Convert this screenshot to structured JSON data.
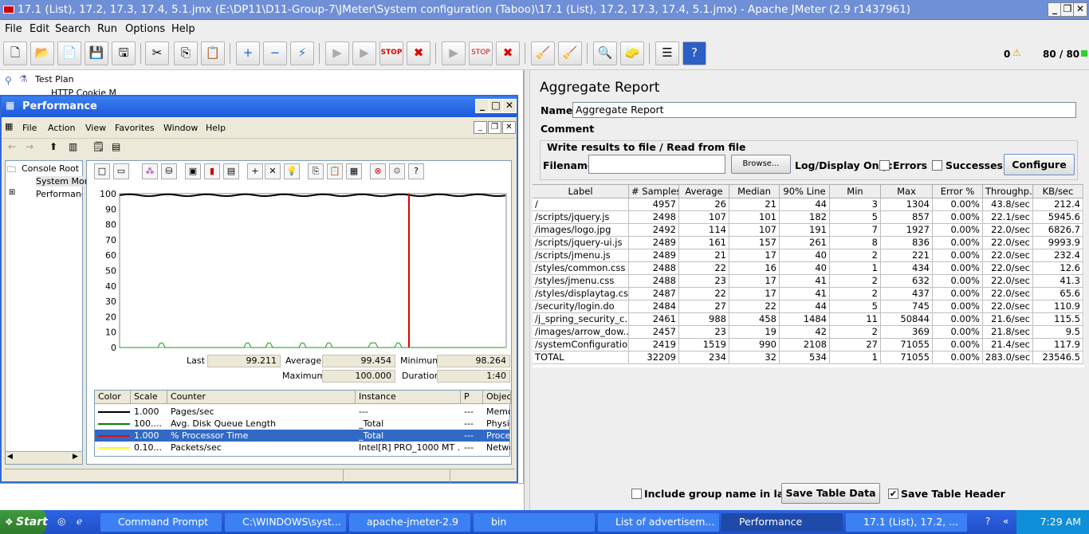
{
  "window": {
    "title": "17.1 (List), 17.2, 17.3, 17.4, 5.1.jmx (E:\\DP11\\D11-Group-7\\JMeter\\System configuration (Taboo)\\17.1 (List), 17.2, 17.3, 17.4, 5.1.jmx) - Apache JMeter (2.9 r1437961)"
  },
  "menu": [
    "File",
    "Edit",
    "Search",
    "Run",
    "Options",
    "Help"
  ],
  "status": {
    "errors": "0",
    "threads": "80 / 80"
  },
  "tree": {
    "test_plan": "Test Plan",
    "http_cookie": "HTTP Cookie M"
  },
  "perfmon": {
    "title": "Performance",
    "menu": [
      "File",
      "Action",
      "View",
      "Favorites",
      "Window",
      "Help"
    ],
    "tree": [
      "Console Root",
      "System Mon",
      "Performance"
    ],
    "y_ticks": [
      "100",
      "90",
      "80",
      "70",
      "60",
      "50",
      "40",
      "30",
      "20",
      "10",
      "0"
    ],
    "stats": {
      "last_label": "Last",
      "last": "99.211",
      "avg_label": "Average",
      "avg": "99.454",
      "min_label": "Minimum",
      "min": "98.264",
      "max_label": "Maximum",
      "max": "100.000",
      "dur_label": "Duration",
      "dur": "1:40"
    },
    "legend_headers": [
      "Color",
      "Scale",
      "Counter",
      "Instance",
      "P",
      "Object"
    ],
    "legend_rows": [
      {
        "color": "#000000",
        "scale": "1.000",
        "counter": "Pages/sec",
        "instance": "---",
        "p": "---",
        "object": "Memory"
      },
      {
        "color": "#008000",
        "scale": "100....",
        "counter": "Avg. Disk Queue Length",
        "instance": "_Total",
        "p": "---",
        "object": "PhysicalDisk"
      },
      {
        "color": "#ff0000",
        "scale": "1.000",
        "counter": "% Processor Time",
        "instance": "_Total",
        "p": "---",
        "object": "Processor"
      },
      {
        "color": "#ffff00",
        "scale": "0.10...",
        "counter": "Packets/sec",
        "instance": "Intel[R] PRO_1000 MT ...",
        "p": "---",
        "object": "Network"
      }
    ]
  },
  "report": {
    "title": "Aggregate Report",
    "name_label": "Name:",
    "name_value": "Aggregate Report",
    "comments_label": "Comments:",
    "fieldset": "Write results to file / Read from file",
    "filename_label": "Filename",
    "browse": "Browse...",
    "log_label": "Log/Display Only:",
    "errors": "Errors",
    "successes": "Successes",
    "configure": "Configure",
    "headers": [
      "Label",
      "# Samples",
      "Average",
      "Median",
      "90% Line",
      "Min",
      "Max",
      "Error %",
      "Throughp...",
      "KB/sec"
    ],
    "rows": [
      [
        "/",
        "4957",
        "26",
        "21",
        "44",
        "3",
        "1304",
        "0.00%",
        "43.8/sec",
        "212.4"
      ],
      [
        "/scripts/jquery.js",
        "2498",
        "107",
        "101",
        "182",
        "5",
        "857",
        "0.00%",
        "22.1/sec",
        "5945.6"
      ],
      [
        "/images/logo.jpg",
        "2492",
        "114",
        "107",
        "191",
        "7",
        "1927",
        "0.00%",
        "22.0/sec",
        "6826.7"
      ],
      [
        "/scripts/jquery-ui.js",
        "2489",
        "161",
        "157",
        "261",
        "8",
        "836",
        "0.00%",
        "22.0/sec",
        "9993.9"
      ],
      [
        "/scripts/jmenu.js",
        "2489",
        "21",
        "17",
        "40",
        "2",
        "221",
        "0.00%",
        "22.0/sec",
        "232.4"
      ],
      [
        "/styles/common.css",
        "2488",
        "22",
        "16",
        "40",
        "1",
        "434",
        "0.00%",
        "22.0/sec",
        "12.6"
      ],
      [
        "/styles/jmenu.css",
        "2488",
        "23",
        "17",
        "41",
        "2",
        "632",
        "0.00%",
        "22.0/sec",
        "41.3"
      ],
      [
        "/styles/displaytag.css",
        "2487",
        "22",
        "17",
        "41",
        "2",
        "437",
        "0.00%",
        "22.0/sec",
        "65.6"
      ],
      [
        "/security/login.do",
        "2484",
        "27",
        "22",
        "44",
        "5",
        "745",
        "0.00%",
        "22.0/sec",
        "110.9"
      ],
      [
        "/j_spring_security_c...",
        "2461",
        "988",
        "458",
        "1484",
        "11",
        "50844",
        "0.00%",
        "21.6/sec",
        "115.5"
      ],
      [
        "/images/arrow_dow...",
        "2457",
        "23",
        "19",
        "42",
        "2",
        "369",
        "0.00%",
        "21.8/sec",
        "9.5"
      ],
      [
        "/systemConfiguratio...",
        "2419",
        "1519",
        "990",
        "2108",
        "27",
        "71055",
        "0.00%",
        "21.4/sec",
        "117.9"
      ],
      [
        "TOTAL",
        "32209",
        "234",
        "32",
        "534",
        "1",
        "71055",
        "0.00%",
        "283.0/sec",
        "23546.5"
      ]
    ],
    "include_group": "Include group name in label?",
    "save_table": "Save Table Data",
    "save_header": "Save Table Header"
  },
  "taskbar": {
    "start": "Start",
    "tasks": [
      "Command Prompt",
      "C:\\WINDOWS\\syst...",
      "apache-jmeter-2.9",
      "bin",
      "List of advertisem...",
      "Performance",
      "17.1 (List), 17.2, ..."
    ],
    "time": "7:29 AM"
  }
}
